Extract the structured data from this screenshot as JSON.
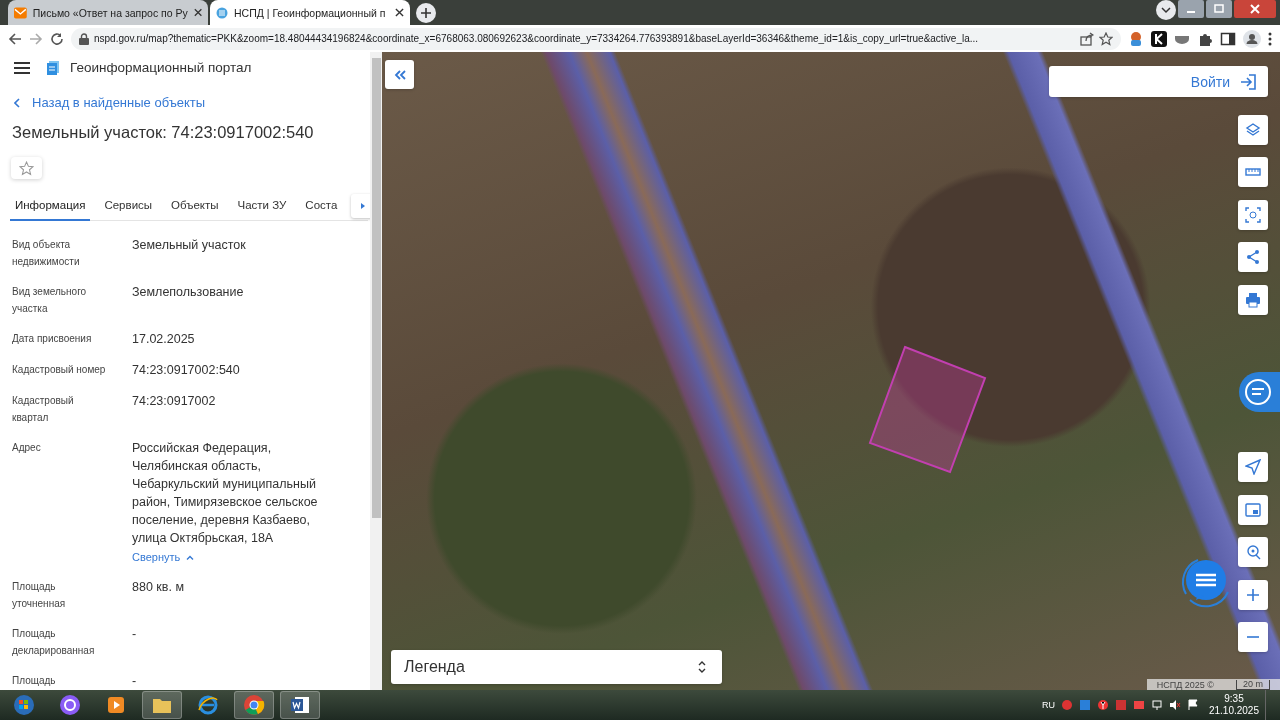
{
  "browser": {
    "tabs": [
      {
        "title": "Письмо «Ответ на запрос по Ру",
        "selected": false
      },
      {
        "title": "НСПД | Геоинформационный п",
        "selected": true
      }
    ],
    "url": "nspd.gov.ru/map?thematic=PKK&zoom=18.48044434196824&coordinate_x=6768063.080692623&coordinate_y=7334264.776393891&baseLayerId=36346&theme_id=1&is_copy_url=true&active_la..."
  },
  "portal": {
    "title": "Геоинформационный портал",
    "back_link": "Назад в найденные объекты",
    "heading": "Земельный участок: 74:23:0917002:540",
    "favorite": false,
    "tabs": [
      {
        "label": "Информация",
        "selected": true
      },
      {
        "label": "Сервисы",
        "selected": false
      },
      {
        "label": "Объекты",
        "selected": false
      },
      {
        "label": "Части ЗУ",
        "selected": false
      },
      {
        "label": "Соста",
        "selected": false
      }
    ],
    "fields": [
      {
        "label": "Вид объекта недвижимости",
        "value": "Земельный участок"
      },
      {
        "label": "Вид земельного участка",
        "value": "Землепользование"
      },
      {
        "label": "Дата присвоения",
        "value": "17.02.2025"
      },
      {
        "label": "Кадастровый номер",
        "value": "74:23:0917002:540"
      },
      {
        "label": "Кадастровый квартал",
        "value": "74:23:0917002"
      },
      {
        "label": "Адрес",
        "value": "Российская Федерация, Челябинская область, Чебаркульский муниципальный район, Тимирязевское сельское поселение, деревня Казбаево, улица Октябрьская, 18А",
        "link": "Свернуть"
      },
      {
        "label": "Площадь уточненная",
        "value": "880 кв. м"
      },
      {
        "label": "Площадь декларированная",
        "value": "-"
      },
      {
        "label": "Площадь",
        "value": "-"
      }
    ]
  },
  "map": {
    "login": "Войти",
    "legend": "Легенда",
    "attribution": "НСПД 2025 ©",
    "scale": "20 m"
  },
  "taskbar": {
    "language": "RU",
    "time": "9:35",
    "date": "21.10.2025"
  }
}
